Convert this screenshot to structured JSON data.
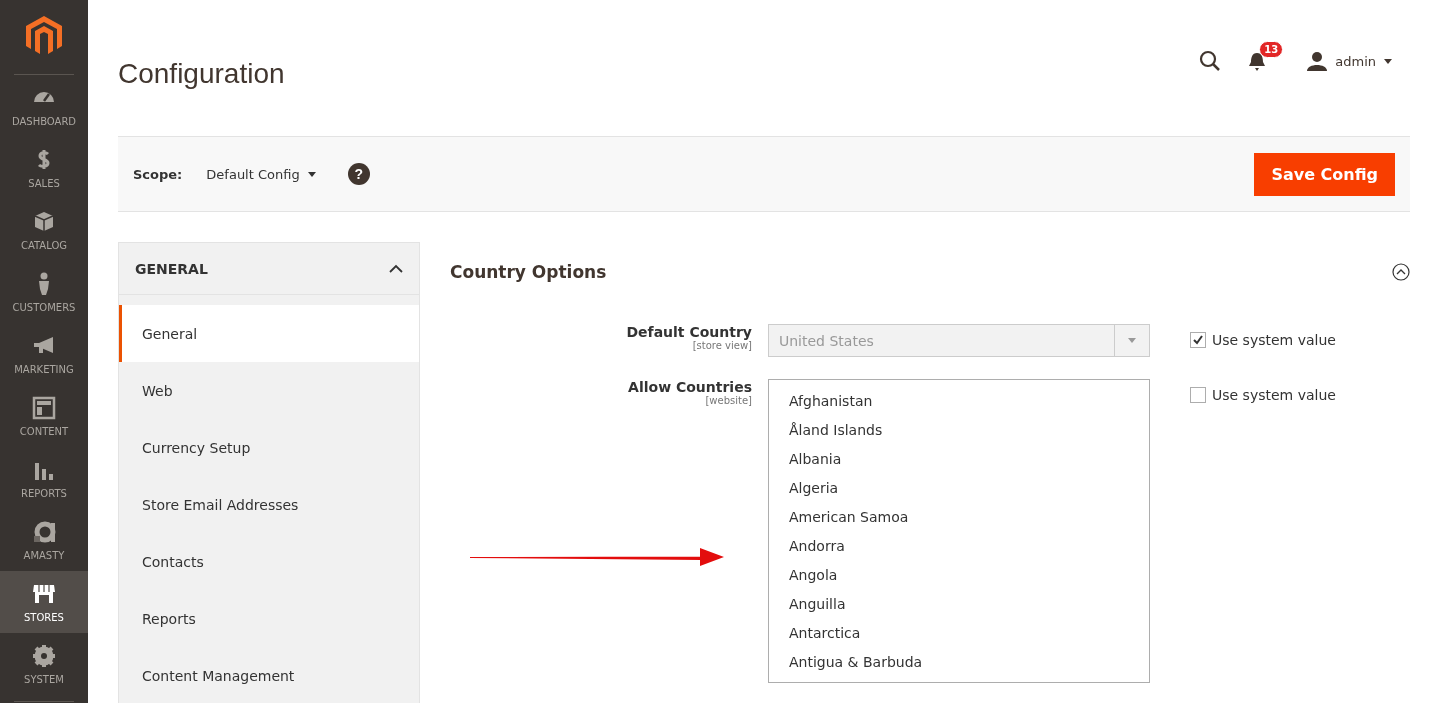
{
  "sidebar": {
    "items": [
      {
        "label": "DASHBOARD",
        "selected": false
      },
      {
        "label": "SALES",
        "selected": false
      },
      {
        "label": "CATALOG",
        "selected": false
      },
      {
        "label": "CUSTOMERS",
        "selected": false
      },
      {
        "label": "MARKETING",
        "selected": false
      },
      {
        "label": "CONTENT",
        "selected": false
      },
      {
        "label": "REPORTS",
        "selected": false
      },
      {
        "label": "AMASTY",
        "selected": false
      },
      {
        "label": "STORES",
        "selected": true
      },
      {
        "label": "SYSTEM",
        "selected": false
      }
    ]
  },
  "header": {
    "title": "Configuration",
    "notifications": "13",
    "user": "admin"
  },
  "scope_bar": {
    "label": "Scope:",
    "value": "Default Config",
    "help": "?",
    "save_button": "Save Config"
  },
  "config_nav": {
    "section": "GENERAL",
    "expanded": true,
    "items": [
      {
        "label": "General",
        "selected": true
      },
      {
        "label": "Web",
        "selected": false
      },
      {
        "label": "Currency Setup",
        "selected": false
      },
      {
        "label": "Store Email Addresses",
        "selected": false
      },
      {
        "label": "Contacts",
        "selected": false
      },
      {
        "label": "Reports",
        "selected": false
      },
      {
        "label": "Content Management",
        "selected": false
      }
    ]
  },
  "country_options": {
    "title": "Country Options",
    "expanded": true,
    "default_country": {
      "label": "Default Country",
      "scope": "[store view]",
      "value": "United States",
      "disabled": true,
      "use_system_label": "Use system value",
      "use_system": true
    },
    "allow_countries": {
      "label": "Allow Countries",
      "scope": "[website]",
      "use_system_label": "Use system value",
      "use_system": false,
      "options": [
        {
          "label": "Afghanistan",
          "selected": false
        },
        {
          "label": "Åland Islands",
          "selected": false
        },
        {
          "label": "Albania",
          "selected": false
        },
        {
          "label": "Algeria",
          "selected": false
        },
        {
          "label": "American Samoa",
          "selected": false
        },
        {
          "label": "Andorra",
          "selected": false
        },
        {
          "label": "Angola",
          "selected": false
        },
        {
          "label": "Anguilla",
          "selected": false
        },
        {
          "label": "Antarctica",
          "selected": false
        },
        {
          "label": "Antigua & Barbuda",
          "selected": false
        }
      ]
    }
  }
}
